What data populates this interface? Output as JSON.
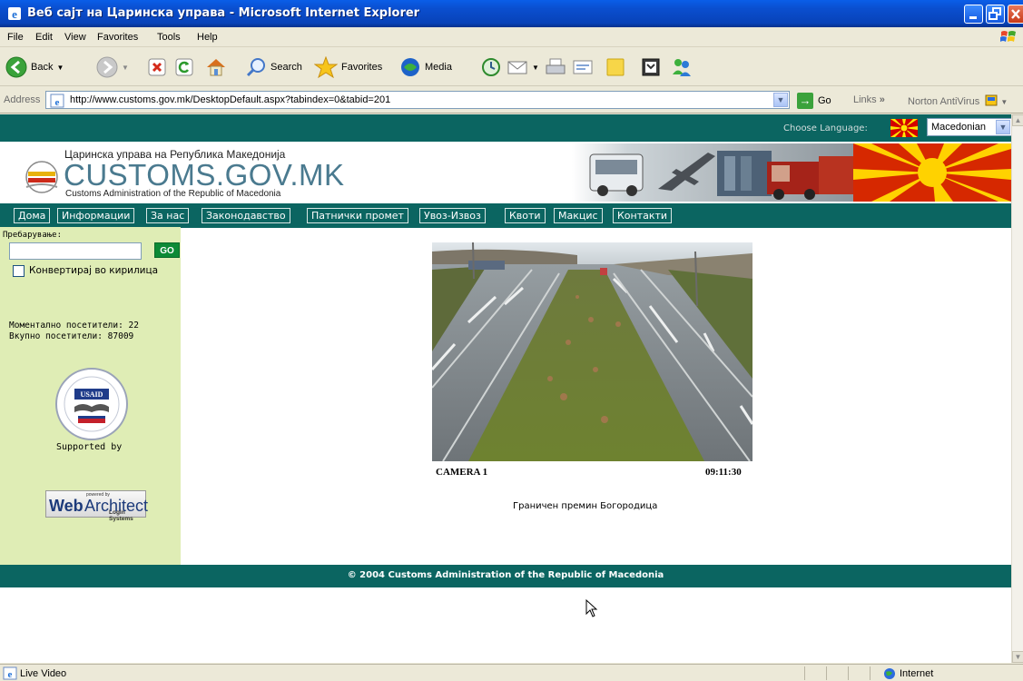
{
  "window": {
    "title": "Веб сајт на Царинска управа - Microsoft Internet Explorer"
  },
  "menu": [
    "File",
    "Edit",
    "View",
    "Favorites",
    "Tools",
    "Help"
  ],
  "toolbar": {
    "back": "Back",
    "search": "Search",
    "favorites": "Favorites",
    "media": "Media"
  },
  "address": {
    "label": "Address",
    "url": "http://www.customs.gov.mk/DesktopDefault.aspx?tabindex=0&tabid=201",
    "go": "Go",
    "links": "Links",
    "links_chevron": "»",
    "norton": "Norton AntiVirus"
  },
  "page": {
    "language_label": "Choose Language:",
    "language_value": "Macedonian",
    "banner": {
      "org_mk": "Царинска управа на Република Македонија",
      "site": "CUSTOMS.GOV.MK",
      "org_en": "Customs Administration of the Republic of Macedonia"
    },
    "nav": [
      "Дома",
      "Информации",
      "За нас",
      "Законодавство",
      "Патнички промет",
      "Увоз-Извоз",
      "Квоти",
      "Макцис",
      "Контакти"
    ],
    "search_label": "Пребарување:",
    "search_button": "GO",
    "convert_label": "Конвертирај во кирилица",
    "visitors_now": "Моментално посетители: 22",
    "visitors_total": "Вкупно посетители: 87009",
    "usaid_label": "USAID",
    "supported_by": "Supported by",
    "webarchitect": {
      "powered": "powered by",
      "web": "Web",
      "architect": "Architect",
      "systems": "Login Systems"
    },
    "camera_label": "CAMERA 1",
    "camera_time": "09:11:30",
    "crossing": "Граничен премин Богородица",
    "footer": "© 2004 Customs Administration of the Republic of Macedonia"
  },
  "status": {
    "text": "Live Video",
    "zone": "Internet"
  },
  "colors": {
    "titlebar": "#0a4fd0",
    "site_teal": "#0b6561",
    "sidebar": "#dfedb5",
    "go_green": "#0c8a36"
  }
}
